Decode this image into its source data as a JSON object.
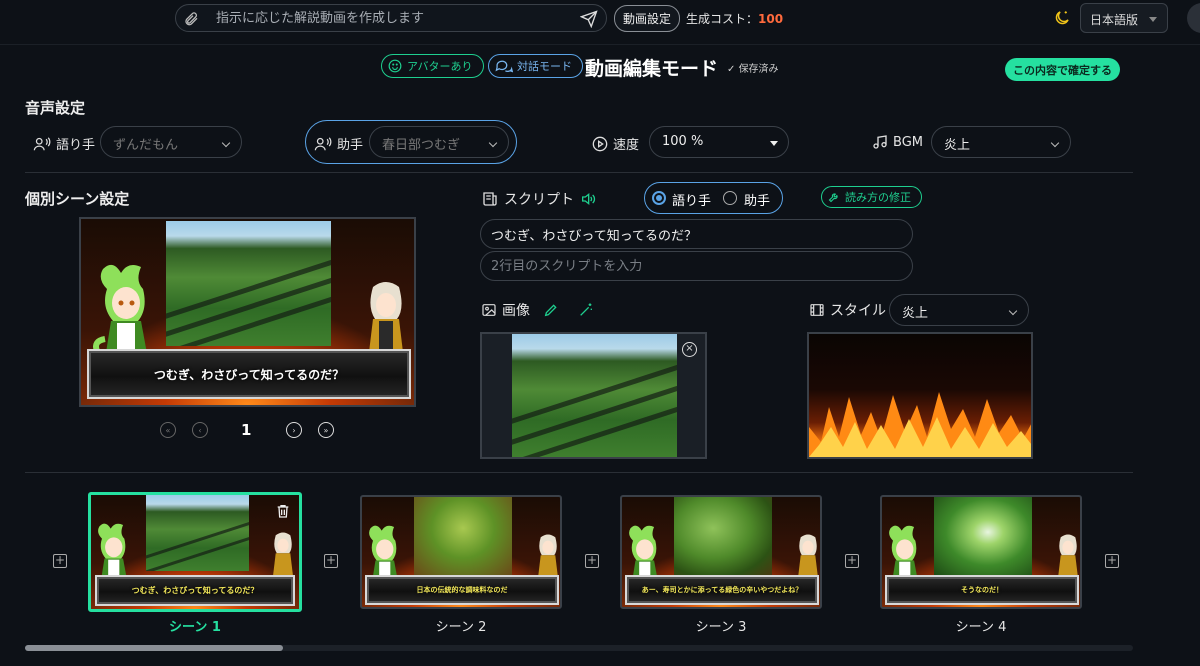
{
  "top": {
    "search_placeholder": "指示に応じた解説動画を作成します",
    "video_settings": "動画設定",
    "cost_label": "生成コスト：",
    "cost_value": "100",
    "language": "日本語版"
  },
  "mode": {
    "avatar_toggle": "アバターあり",
    "dialogue_toggle": "対話モード",
    "title": "動画編集モード",
    "saved": "保存済み",
    "confirm": "この内容で確定する"
  },
  "voice": {
    "section_title": "音声設定",
    "narrator_label": "語り手",
    "narrator_value": "ずんだもん",
    "assistant_label": "助手",
    "assistant_value": "春日部つむぎ",
    "speed_label": "速度",
    "speed_value": "100 %",
    "bgm_label": "BGM",
    "bgm_value": "炎上"
  },
  "scene": {
    "section_title": "個別シーン設定",
    "subtitle": "つむぎ、わさびって知ってるのだ？",
    "page": "1",
    "script_label": "スクリプト",
    "speaker_narrator": "語り手",
    "speaker_assistant": "助手",
    "reading_fix": "読み方の修正",
    "line1": "つむぎ、わさびって知ってるのだ？",
    "line2_placeholder": "2行目のスクリプトを入力",
    "image_label": "画像",
    "style_label": "スタイル",
    "style_value": "炎上"
  },
  "thumbnails": [
    {
      "label": "シーン 1",
      "caption": "つむぎ、わさびって知ってるのだ？"
    },
    {
      "label": "シーン 2",
      "caption": "日本の伝統的な調味料なのだ"
    },
    {
      "label": "シーン 3",
      "caption": "あー、寿司とかに添ってる緑色の辛いやつだよね？"
    },
    {
      "label": "シーン 4",
      "caption": "そうなのだ！"
    }
  ],
  "colors": {
    "accent_green": "#25e0a0",
    "accent_blue": "#5aa3e6",
    "cost": "#ff6a3d"
  }
}
